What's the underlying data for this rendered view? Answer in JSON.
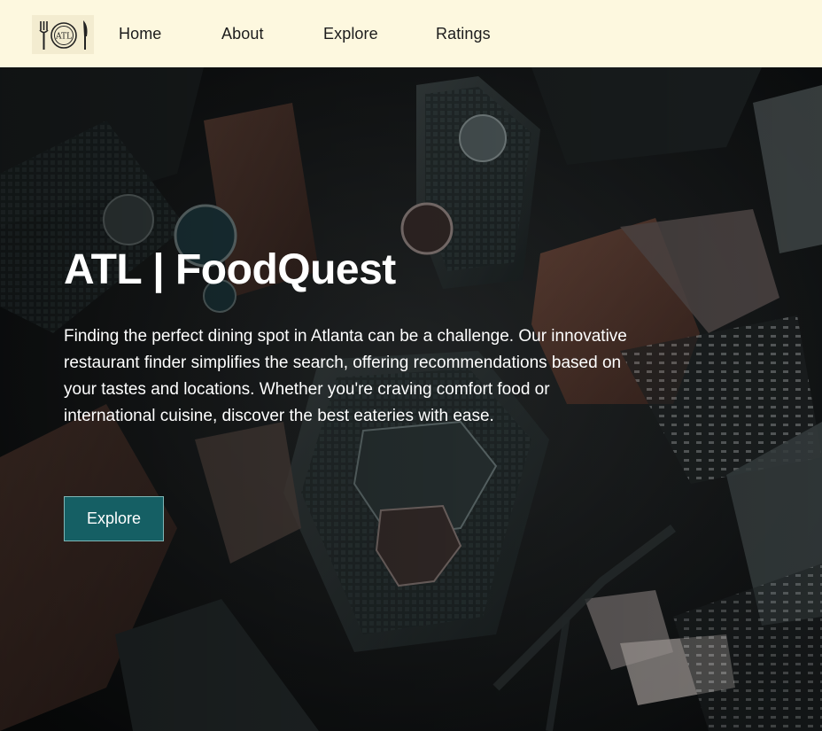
{
  "nav": {
    "logo_text": "ATL",
    "items": [
      {
        "label": "Home"
      },
      {
        "label": "About"
      },
      {
        "label": "Explore"
      },
      {
        "label": "Ratings"
      }
    ],
    "background": "#fdf8df"
  },
  "hero": {
    "title": "ATL | FoodQuest",
    "description": "Finding the perfect dining spot in Atlanta can be a challenge. Our innovative restaurant finder simplifies the search, offering recommendations based on your tastes and locations. Whether you're craving comfort food or international cuisine, discover the best eateries with ease.",
    "button_label": "Explore",
    "button_color": "#155f64",
    "background_image": "aerial-city-photo"
  }
}
